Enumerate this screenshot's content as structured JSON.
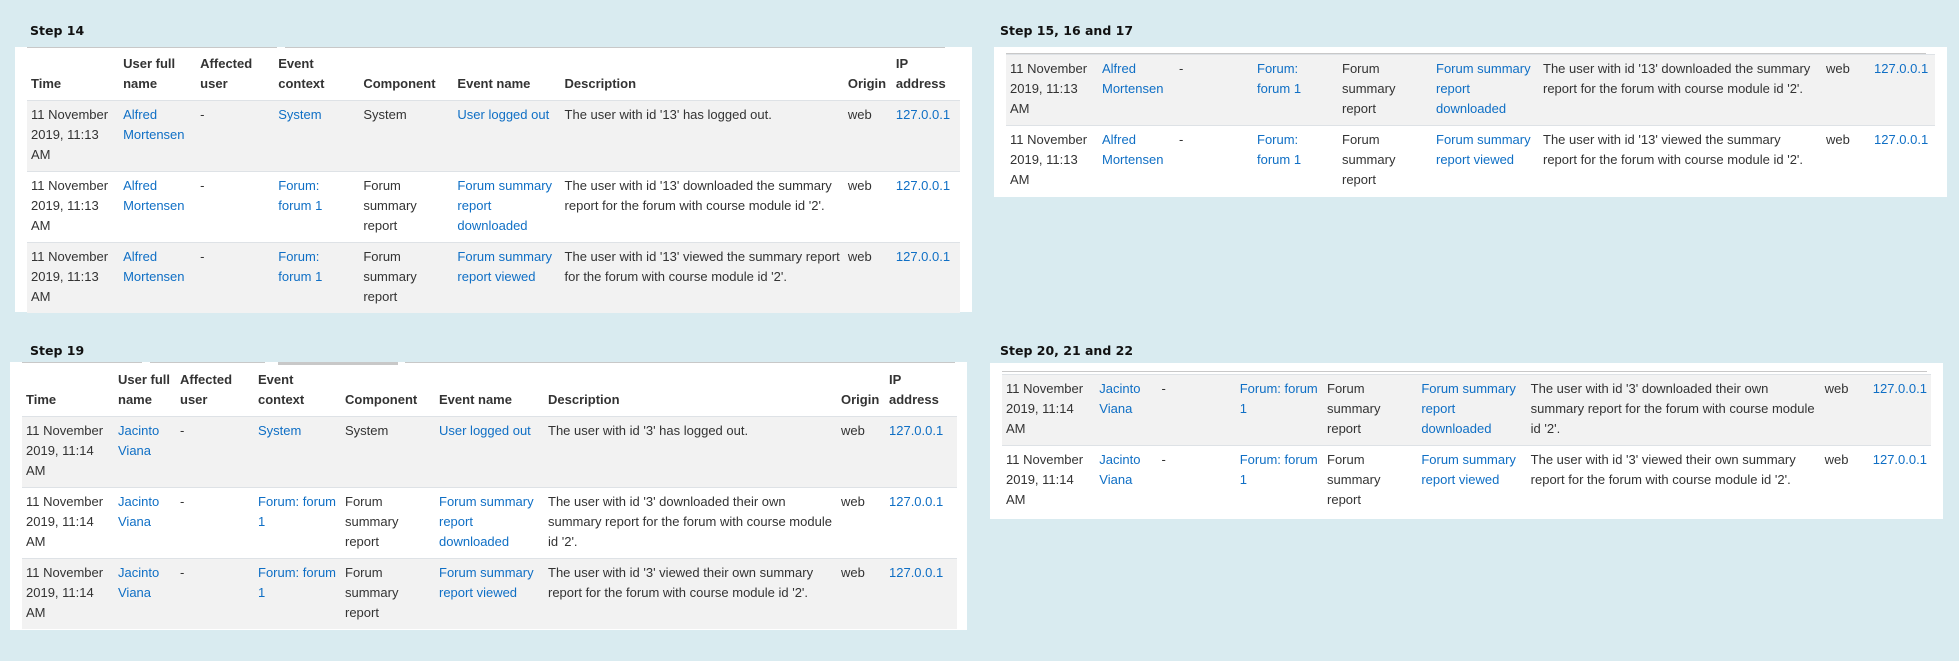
{
  "headers": {
    "time": "Time",
    "user": "User full name",
    "affected": "Affected user",
    "context": "Event context",
    "component": "Component",
    "event": "Event name",
    "description": "Description",
    "origin": "Origin",
    "ip": "IP address"
  },
  "panels": {
    "step14": {
      "title": "Step 14",
      "rows": [
        {
          "time": "11 November 2019, 11:13 AM",
          "user": "Alfred Mortensen",
          "affected": "-",
          "context": "System",
          "component": "System",
          "event": "User logged out",
          "description": "The user with id '13' has logged out.",
          "origin": "web",
          "ip": "127.0.0.1"
        },
        {
          "time": "11 November 2019, 11:13 AM",
          "user": "Alfred Mortensen",
          "affected": "-",
          "context": "Forum: forum 1",
          "component": "Forum summary report",
          "event": "Forum summary report downloaded",
          "description": "The user with id '13' downloaded the summary report for the forum with course module id '2'.",
          "origin": "web",
          "ip": "127.0.0.1"
        },
        {
          "time": "11 November 2019, 11:13 AM",
          "user": "Alfred Mortensen",
          "affected": "-",
          "context": "Forum: forum 1",
          "component": "Forum summary report",
          "event": "Forum summary report viewed",
          "description": "The user with id '13' viewed the summary report for the forum with course module id '2'.",
          "origin": "web",
          "ip": "127.0.0.1"
        }
      ]
    },
    "step15": {
      "title": "Step 15, 16 and 17",
      "rows": [
        {
          "time": "11 November 2019, 11:13 AM",
          "user": "Alfred Mortensen",
          "affected": "-",
          "context": "Forum: forum 1",
          "component": "Forum summary report",
          "event": "Forum summary report downloaded",
          "description": "The user with id '13' downloaded the summary report for the forum with course module id '2'.",
          "origin": "web",
          "ip": "127.0.0.1"
        },
        {
          "time": "11 November 2019, 11:13 AM",
          "user": "Alfred Mortensen",
          "affected": "-",
          "context": "Forum: forum 1",
          "component": "Forum summary report",
          "event": "Forum summary report viewed",
          "description": "The user with id '13' viewed the summary report for the forum with course module id '2'.",
          "origin": "web",
          "ip": "127.0.0.1"
        }
      ]
    },
    "step19": {
      "title": "Step 19",
      "rows": [
        {
          "time": "11 November 2019, 11:14 AM",
          "user": "Jacinto Viana",
          "affected": "-",
          "context": "System",
          "component": "System",
          "event": "User logged out",
          "description": "The user with id '3' has logged out.",
          "origin": "web",
          "ip": "127.0.0.1"
        },
        {
          "time": "11 November 2019, 11:14 AM",
          "user": "Jacinto Viana",
          "affected": "-",
          "context": "Forum: forum 1",
          "component": "Forum summary report",
          "event": "Forum summary report downloaded",
          "description": "The user with id '3' downloaded their own summary report for the forum with course module id '2'.",
          "origin": "web",
          "ip": "127.0.0.1"
        },
        {
          "time": "11 November 2019, 11:14 AM",
          "user": "Jacinto Viana",
          "affected": "-",
          "context": "Forum: forum 1",
          "component": "Forum summary report",
          "event": "Forum summary report viewed",
          "description": "The user with id '3' viewed their own summary report for the forum with course module id '2'.",
          "origin": "web",
          "ip": "127.0.0.1"
        }
      ]
    },
    "step20": {
      "title": "Step 20, 21 and 22",
      "rows": [
        {
          "time": "11 November 2019, 11:14 AM",
          "user": "Jacinto Viana",
          "affected": "-",
          "context": "Forum: forum 1",
          "component": "Forum summary report",
          "event": "Forum summary report downloaded",
          "description": "The user with id '3' downloaded their own summary report for the forum with course module id '2'.",
          "origin": "web",
          "ip": "127.0.0.1"
        },
        {
          "time": "11 November 2019, 11:14 AM",
          "user": "Jacinto Viana",
          "affected": "-",
          "context": "Forum: forum 1",
          "component": "Forum summary report",
          "event": "Forum summary report viewed",
          "description": "The user with id '3' viewed their own summary report for the forum with course module id '2'.",
          "origin": "web",
          "ip": "127.0.0.1"
        }
      ]
    }
  }
}
